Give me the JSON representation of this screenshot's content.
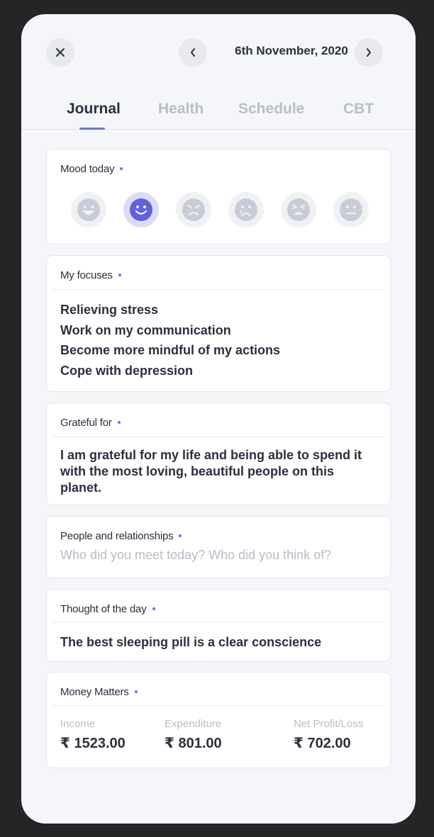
{
  "header": {
    "date": "6th November, 2020"
  },
  "tabs": [
    {
      "label": "Journal",
      "active": true
    },
    {
      "label": "Health",
      "active": false
    },
    {
      "label": "Schedule",
      "active": false
    },
    {
      "label": "CBT",
      "active": false
    }
  ],
  "mood": {
    "title": "Mood today",
    "options": [
      "laughing-face-icon",
      "smiling-face-icon",
      "angry-face-icon",
      "crying-face-icon",
      "frustrated-face-icon",
      "neutral-face-icon"
    ],
    "selected_index": 1
  },
  "focuses": {
    "title": "My focuses",
    "items": [
      "Relieving stress",
      "Work on my communication",
      "Become more mindful of my actions",
      "Cope with depression"
    ]
  },
  "grateful": {
    "title": "Grateful for",
    "text": "I am grateful for my life and being able to spend it with the most loving, beautiful people on this planet."
  },
  "people": {
    "title": "People and relationships",
    "placeholder": "Who did you meet today? Who did you think of?"
  },
  "thought": {
    "title": "Thought of the day",
    "text": "The best sleeping pill is a clear conscience"
  },
  "money": {
    "title": "Money Matters",
    "income_label": "Income",
    "income_value": "₹ 1523.00",
    "expenditure_label": "Expenditure",
    "expenditure_value": "₹ 801.00",
    "net_label": "Net Profit/Loss",
    "net_value": "₹ 702.00"
  },
  "colors": {
    "accent": "#6b6fe6",
    "text": "#2c2f3e",
    "muted": "#b9bdc9",
    "background": "#f5f6f9"
  }
}
